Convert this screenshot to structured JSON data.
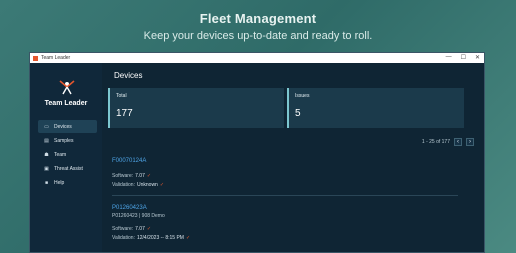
{
  "hero": {
    "title": "Fleet Management",
    "subtitle": "Keep your devices up-to-date and ready to roll."
  },
  "window": {
    "title": "Team Leader",
    "controls": [
      "—",
      "☐",
      "✕"
    ]
  },
  "sidebar": {
    "brand": "Team Leader",
    "items": [
      {
        "label": "Devices",
        "icon": "device-icon",
        "glyph": "▭",
        "active": true
      },
      {
        "label": "Samples",
        "icon": "samples-icon",
        "glyph": "▤",
        "active": false
      },
      {
        "label": "Team",
        "icon": "team-icon",
        "glyph": "☗",
        "active": false
      },
      {
        "label": "Threat Assist",
        "icon": "threat-assist-icon",
        "glyph": "▣",
        "active": false
      },
      {
        "label": "Help",
        "icon": "help-icon",
        "glyph": "■",
        "active": false
      }
    ]
  },
  "main": {
    "title": "Devices",
    "cards": {
      "total_label": "Total",
      "total_value": "177",
      "issues_label": "Issues",
      "issues_value": "5"
    },
    "pager": {
      "range": "1 - 25 of 177",
      "prev": "‹",
      "next": "›"
    },
    "devices": [
      {
        "id": "F00070124A",
        "description": "",
        "software_label": "Software:",
        "software": "7.07",
        "validation_label": "Validation:",
        "validation": "Unknown"
      },
      {
        "id": "P01260423A",
        "description": "P01260423 | 908 Demo",
        "software_label": "Software:",
        "software": "7.07",
        "validation_label": "Validation:",
        "validation": "12/4/2023 -- 8:15 PM"
      }
    ]
  },
  "colors": {
    "accent": "#4ea4e6",
    "brand_orange": "#e4572e",
    "window_bg": "#0f2534",
    "card_bg": "#1b3a4b"
  }
}
